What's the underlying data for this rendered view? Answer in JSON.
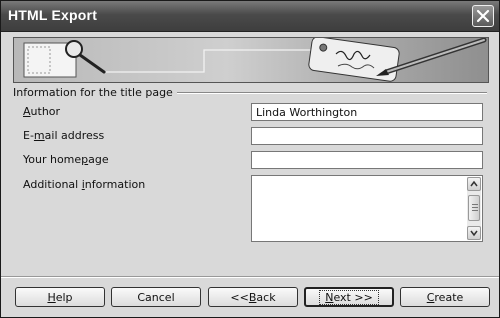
{
  "window": {
    "title": "HTML Export"
  },
  "group": {
    "label": "Information for the title page"
  },
  "fields": {
    "author": {
      "label_pre": "",
      "label_u": "A",
      "label_post": "uthor",
      "value": "Linda Worthington"
    },
    "email": {
      "label_pre": "E-",
      "label_u": "m",
      "label_post": "ail address",
      "value": ""
    },
    "homepage": {
      "label_pre": "Your home",
      "label_u": "p",
      "label_post": "age",
      "value": ""
    },
    "additional": {
      "label_pre": "Additional ",
      "label_u": "i",
      "label_post": "nformation",
      "value": ""
    }
  },
  "buttons": {
    "help": {
      "pre": "",
      "u": "H",
      "post": "elp"
    },
    "cancel": {
      "label": "Cancel"
    },
    "back": {
      "pre": "<< ",
      "u": "B",
      "post": "ack"
    },
    "next": {
      "pre": "",
      "u": "N",
      "post": "ext >>"
    },
    "create": {
      "pre": "",
      "u": "C",
      "post": "reate"
    }
  },
  "icons": {
    "close": "close-icon",
    "banner_left": "magnifier-document-illustration",
    "banner_right": "tag-pen-illustration",
    "scroll_up": "chevron-up-icon",
    "scroll_down": "chevron-down-icon"
  }
}
